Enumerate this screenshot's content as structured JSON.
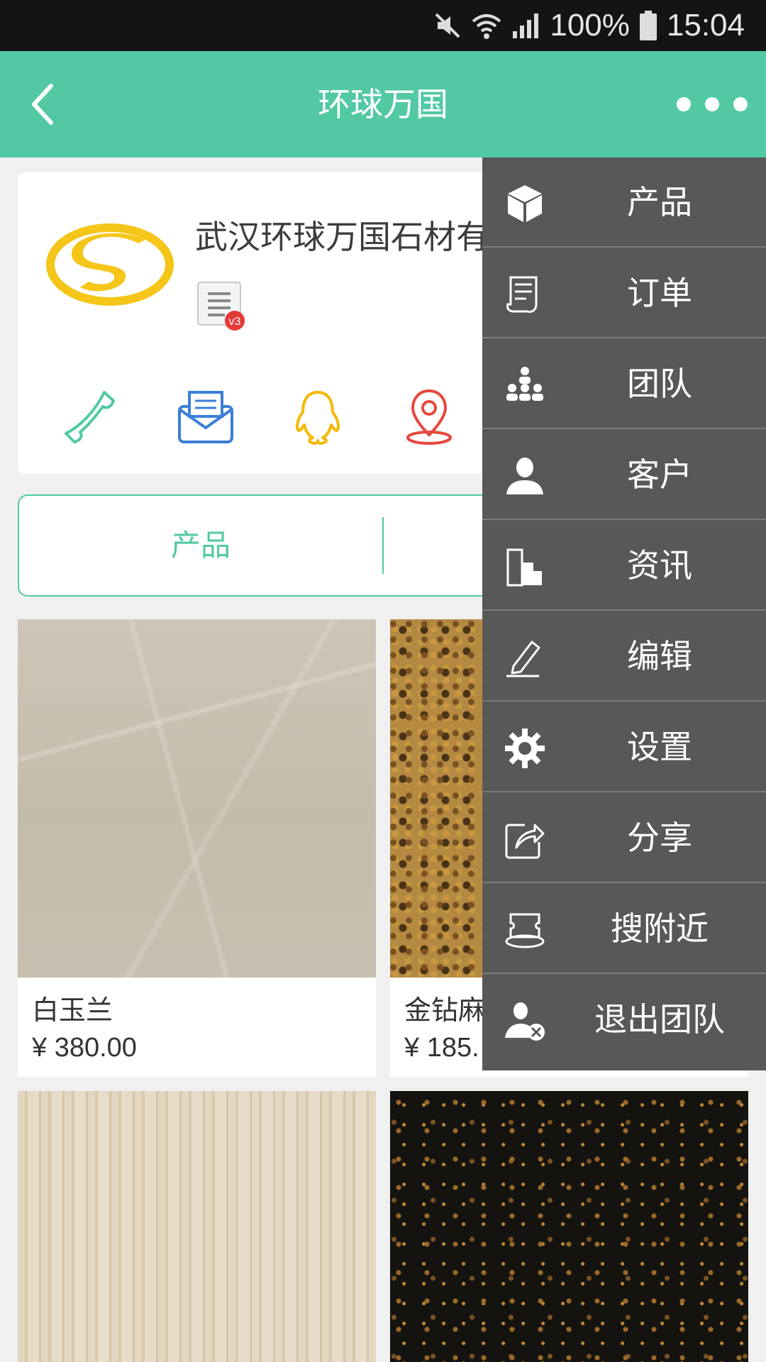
{
  "status_bar": {
    "battery": "100%",
    "time": "15:04"
  },
  "app_bar": {
    "title": "环球万国"
  },
  "company": {
    "name": "武汉环球万国石材有",
    "badge": "v3"
  },
  "tabs": [
    {
      "label": "产品"
    }
  ],
  "products": [
    {
      "name": "白玉兰",
      "price": "¥ 380.00"
    },
    {
      "name": "金钻麻",
      "price": "¥ 185."
    },
    {
      "name": "",
      "price": ""
    },
    {
      "name": "",
      "price": ""
    }
  ],
  "menu": {
    "items": [
      {
        "label": "产品",
        "icon": "cube-icon"
      },
      {
        "label": "订单",
        "icon": "receipt-icon"
      },
      {
        "label": "团队",
        "icon": "team-icon"
      },
      {
        "label": "客户",
        "icon": "person-icon"
      },
      {
        "label": "资讯",
        "icon": "building-icon"
      },
      {
        "label": "编辑",
        "icon": "pencil-icon"
      },
      {
        "label": "设置",
        "icon": "gear-icon"
      },
      {
        "label": "分享",
        "icon": "share-icon"
      },
      {
        "label": "搜附近",
        "icon": "nearby-icon"
      },
      {
        "label": "退出团队",
        "icon": "exit-team-icon"
      }
    ]
  },
  "colors": {
    "accent": "#52c9a4",
    "menu_bg": "#585858",
    "status_bar": "#141414"
  }
}
